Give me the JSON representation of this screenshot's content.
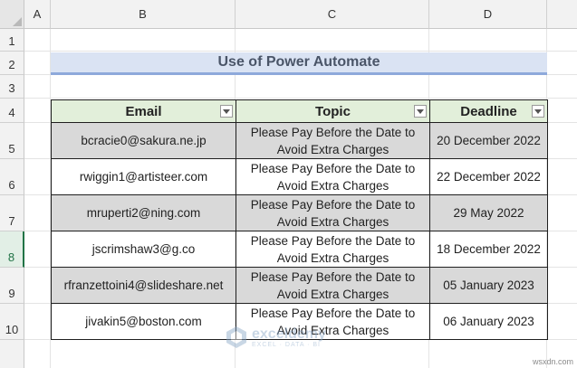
{
  "columns": [
    "A",
    "B",
    "C",
    "D"
  ],
  "rows": [
    "1",
    "2",
    "3",
    "4",
    "5",
    "6",
    "7",
    "8",
    "9",
    "10"
  ],
  "selected_row": "8",
  "title": "Use of Power Automate",
  "table": {
    "headers": [
      "Email",
      "Topic",
      "Deadline"
    ],
    "rows": [
      {
        "email": "bcracie0@sakura.ne.jp",
        "topic_line1": "Please Pay Before the Date to",
        "topic_line2": "Avoid Extra Charges",
        "deadline": "20 December 2022"
      },
      {
        "email": "rwiggin1@artisteer.com",
        "topic_line1": "Please Pay Before the Date to",
        "topic_line2": "Avoid Extra Charges",
        "deadline": "22 December 2022"
      },
      {
        "email": "mruperti2@ning.com",
        "topic_line1": "Please Pay Before the Date to",
        "topic_line2": "Avoid Extra Charges",
        "deadline": "29 May 2022"
      },
      {
        "email": "jscrimshaw3@g.co",
        "topic_line1": "Please Pay Before the Date to",
        "topic_line2": "Avoid Extra Charges",
        "deadline": "18 December 2022"
      },
      {
        "email": "rfranzettoini4@slideshare.net",
        "topic_line1": "Please Pay Before the Date to",
        "topic_line2": "Avoid Extra Charges",
        "deadline": "05 January 2023"
      },
      {
        "email": "jivakin5@boston.com",
        "topic_line1": "Please Pay Before the Date to",
        "topic_line2": "Avoid Extra Charges",
        "deadline": "06 January 2023"
      }
    ]
  },
  "watermark": {
    "name": "exceldemy",
    "tagline": "EXCEL · DATA · BI"
  },
  "source_mark": "wsxdn.com",
  "colors": {
    "title_fill": "#dae3f3",
    "title_underline": "#8ea9db",
    "header_fill": "#e2efda",
    "shaded_row_fill": "#d9d9d9",
    "selection_accent": "#217346"
  }
}
